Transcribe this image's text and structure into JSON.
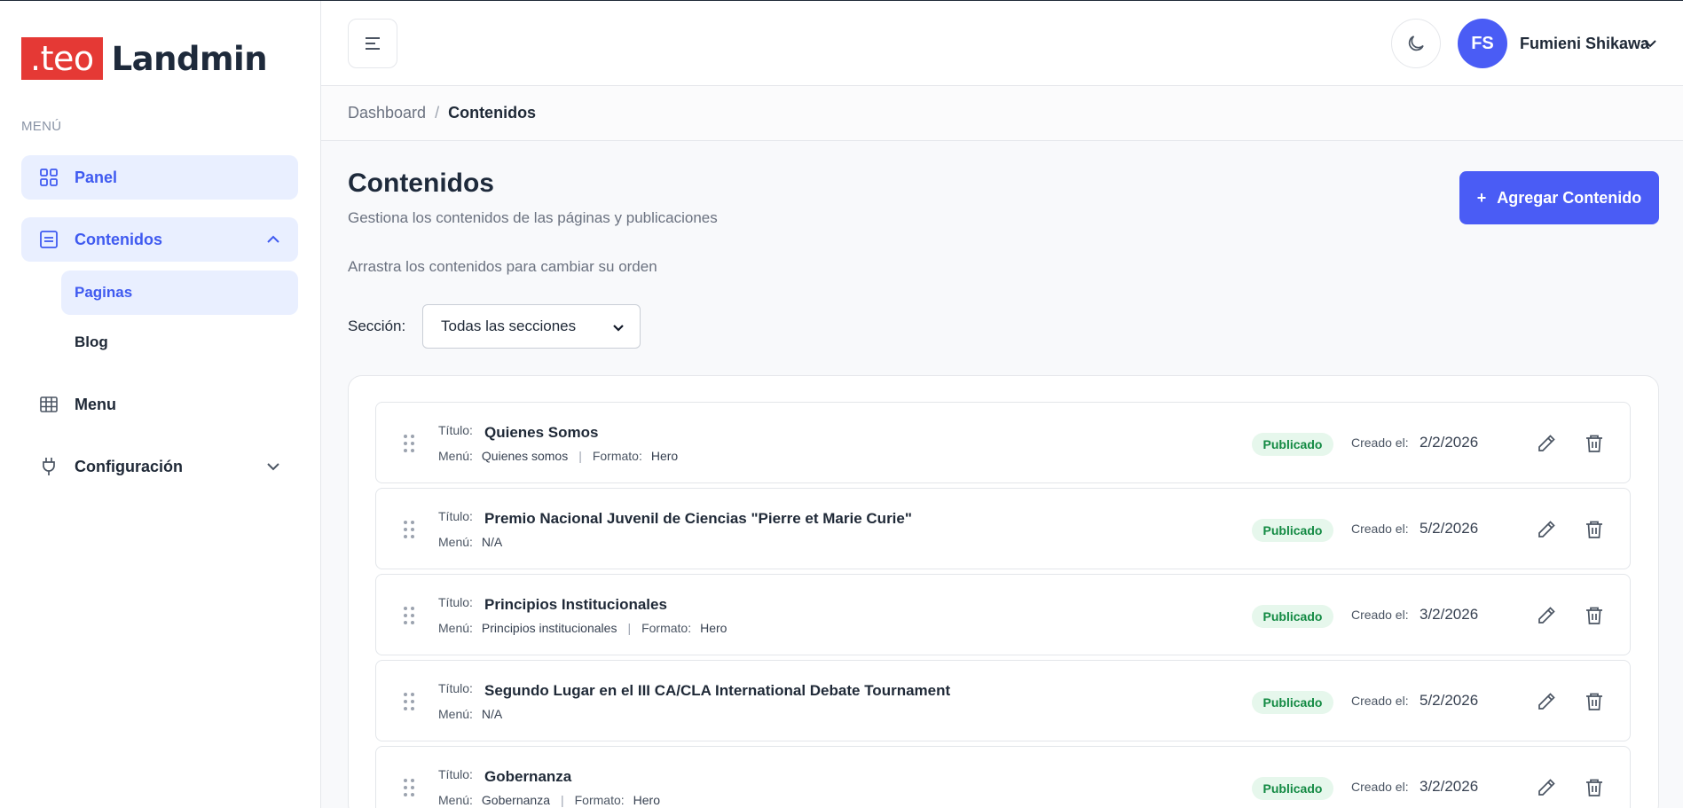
{
  "app": {
    "logo_badge": ".teo",
    "logo_text": "Landmin"
  },
  "colors": {
    "accent": "#4a5cf5",
    "brand_red": "#e53935",
    "success_bg": "#e6f7ec",
    "success_text": "#138a43"
  },
  "sidebar": {
    "menu_label": "MENÚ",
    "items": [
      {
        "label": "Panel",
        "icon": "grid-icon"
      },
      {
        "label": "Contenidos",
        "icon": "document-icon",
        "expanded": true
      },
      {
        "label": "Menu",
        "icon": "table-icon"
      },
      {
        "label": "Configuración",
        "icon": "plug-icon"
      }
    ],
    "subitems": [
      {
        "label": "Paginas"
      },
      {
        "label": "Blog"
      }
    ]
  },
  "header": {
    "avatar_initials": "FS",
    "user_name": "Fumieni Shikawa"
  },
  "breadcrumb": {
    "parent": "Dashboard",
    "separator": "/",
    "current": "Contenidos"
  },
  "main": {
    "title": "Contenidos",
    "subtitle": "Gestiona los contenidos de las páginas y publicaciones",
    "add_button": "Agregar Contenido",
    "drag_hint": "Arrastra los contenidos para cambiar su orden",
    "section_label": "Sección:",
    "section_selected": "Todas las secciones"
  },
  "labels": {
    "title_key": "Título:",
    "menu_key": "Menú:",
    "format_key": "Formato:",
    "created_key": "Creado el:"
  },
  "rows": [
    {
      "title": "Quienes Somos",
      "menu": "Quienes somos",
      "format": "Hero",
      "status": "Publicado",
      "created": "2/2/2026"
    },
    {
      "title": "Premio Nacional Juvenil de Ciencias \"Pierre et Marie Curie\"",
      "menu": "N/A",
      "format": "",
      "status": "Publicado",
      "created": "5/2/2026"
    },
    {
      "title": "Principios Institucionales",
      "menu": "Principios institucionales",
      "format": "Hero",
      "status": "Publicado",
      "created": "3/2/2026"
    },
    {
      "title": "Segundo Lugar en el III CA/CLA International Debate Tournament",
      "menu": "N/A",
      "format": "",
      "status": "Publicado",
      "created": "5/2/2026"
    },
    {
      "title": "Gobernanza",
      "menu": "Gobernanza",
      "format": "Hero",
      "status": "Publicado",
      "created": "3/2/2026"
    }
  ]
}
